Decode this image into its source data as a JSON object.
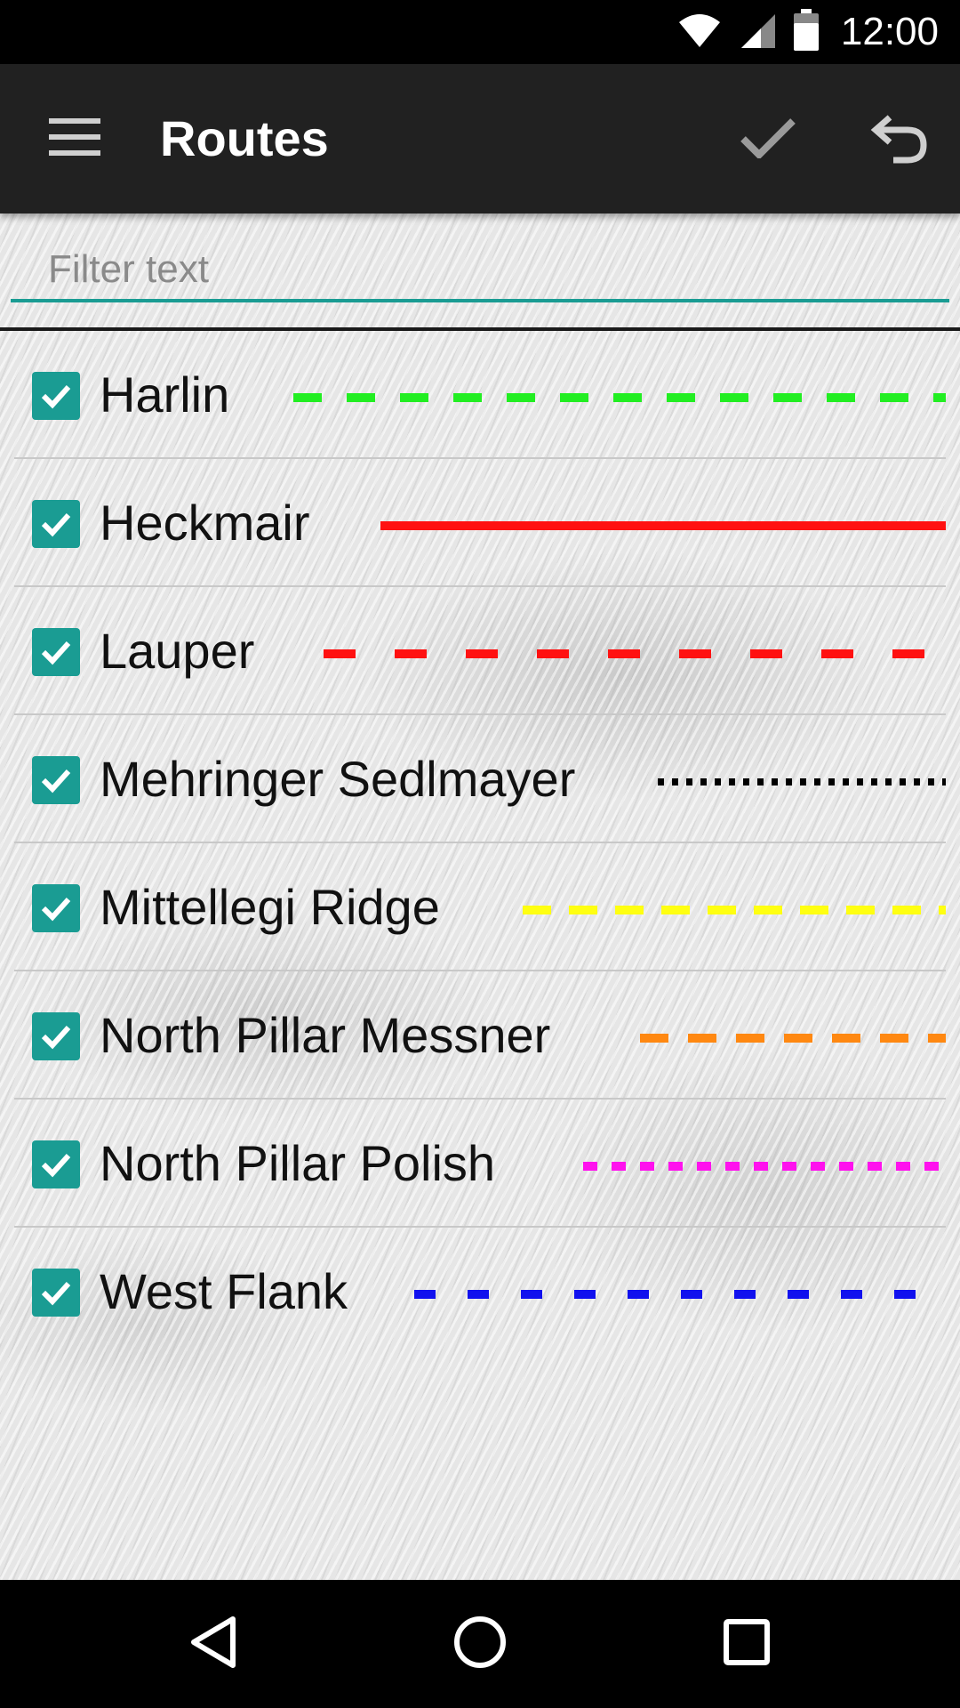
{
  "status_bar": {
    "time": "12:00",
    "icons": [
      "wifi-icon",
      "cell-signal-icon",
      "battery-icon"
    ]
  },
  "app_bar": {
    "title": "Routes",
    "icons": [
      "menu-icon",
      "check-icon",
      "undo-icon"
    ]
  },
  "filter": {
    "placeholder": "Filter text",
    "value": ""
  },
  "routes": [
    {
      "name": "Harlin",
      "checked": true,
      "color": "#22ee22",
      "style": "dashed"
    },
    {
      "name": "Heckmair",
      "checked": true,
      "color": "#ff1111",
      "style": "solid"
    },
    {
      "name": "Lauper",
      "checked": true,
      "color": "#ff1111",
      "style": "dashed"
    },
    {
      "name": "Mehringer Sedlmayer",
      "checked": true,
      "color": "#000000",
      "style": "dotted"
    },
    {
      "name": "Mittellegi Ridge",
      "checked": true,
      "color": "#ffff11",
      "style": "dashed"
    },
    {
      "name": "North Pillar Messner",
      "checked": true,
      "color": "#ff8811",
      "style": "dashed"
    },
    {
      "name": "North Pillar Polish",
      "checked": true,
      "color": "#ff11ee",
      "style": "dashed-short"
    },
    {
      "name": "West Flank",
      "checked": true,
      "color": "#1111ee",
      "style": "dashed"
    }
  ],
  "colors": {
    "accent": "#1a9c93",
    "app_bar": "#212121",
    "status_bar": "#000000"
  },
  "nav_bar": {
    "icons": [
      "back-icon",
      "home-icon",
      "recents-icon"
    ]
  }
}
